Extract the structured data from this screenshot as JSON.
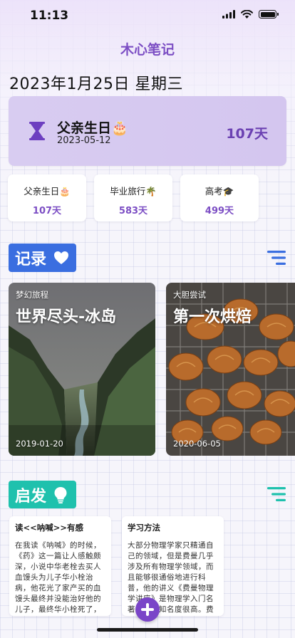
{
  "status": {
    "time": "11:13"
  },
  "app": {
    "title": "木心笔记"
  },
  "today": {
    "date_line": "2023年1月25日 星期三"
  },
  "featured": {
    "name": "父亲生日🎂",
    "date": "2023-05-12",
    "days": "107天",
    "icon": "hourglass-icon"
  },
  "countdowns": [
    {
      "name": "父亲生日🎂",
      "days": "107天"
    },
    {
      "name": "毕业旅行🌴",
      "days": "583天"
    },
    {
      "name": "高考🎓",
      "days": "499天"
    }
  ],
  "records": {
    "section_label": "记录",
    "icon": "heart-icon",
    "cards": [
      {
        "category": "梦幻旅程",
        "title": "世界尽头-冰岛",
        "date": "2019-01-20"
      },
      {
        "category": "大胆尝试",
        "title": "第一次烘焙",
        "date": "2020-06-05"
      }
    ]
  },
  "ideas": {
    "section_label": "启发",
    "icon": "lightbulb-icon",
    "cards": [
      {
        "title": "读<<呐喊>>有感",
        "body": "在我读《呐喊》的时候，《药》这一篇让人感触颇深，小说中华老栓去买人血馒头为儿子华小栓治病，他花光了家产买的血馒头最终并没能治好他的儿子，最终华小栓死了，带着人们的无知与迷信…"
      },
      {
        "title": "学习方法",
        "body": "大部分物理学家只精通自己的领域，但是费曼几乎涉及所有物理学领域，而且能够很通俗地进行科普，他的讲义《费曼物理学讲座》是物理学入门名著，社会知名度很高。费曼的主要思想多学，就必…"
      }
    ]
  },
  "colors": {
    "accent": "#7c4ec4",
    "records": "#3a6ee0",
    "ideas": "#1fc1ad",
    "featured_bg": "#d8ccf1"
  }
}
